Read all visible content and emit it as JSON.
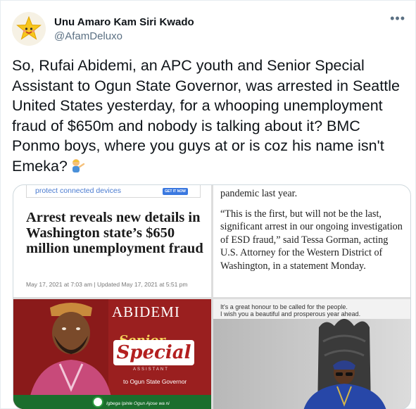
{
  "tweet": {
    "display_name": "Unu Amaro Kam Siri Kwado",
    "handle": "@AfamDeluxo",
    "more_icon": "more-horizontal-icon",
    "text": "So, Rufai Abidemi, an APC youth and Senior Special Assistant to Ogun State Governor, was arrested in Seattle United States yesterday, for a whooping unemployment fraud of $650m and nobody is talking about it? BMC Ponmo boys, where you guys at or is coz his name isn't Emeka?",
    "emoji": "man-tipping-hand-emoji"
  },
  "media": {
    "article": {
      "ad_text": "protect connected devices",
      "ad_button": "GET IT NOW",
      "headline": "Arrest reveals new details in Washington state’s $650 million unemployment fraud",
      "dateline": "May 17, 2021 at 7:03 am | Updated May 17, 2021 at 5:51 pm"
    },
    "quote": {
      "line_first": "pandemic last year.",
      "body": "“This is the first, but will not be the last, significant arrest in our ongoing investigation of ESD fraud,” said Tessa Gorman, acting U.S. Attorney for the Western District of Washington, in a statement Monday."
    },
    "poster": {
      "name": "ABIDEMI",
      "senior": "Senior",
      "special": "Special",
      "assistant": "ASSISTANT",
      "role": "to Ogun State Governor",
      "bottom_text": "Igbega Ipinle Ogun Ajose wa ni",
      "bg_color": "#9a1f1f",
      "accent_color": "#1b6e2d"
    },
    "photo": {
      "caption_line1": "It's a great honour to be called for the people.",
      "caption_line2": "I wish you a beautiful and prosperous year ahead."
    }
  }
}
